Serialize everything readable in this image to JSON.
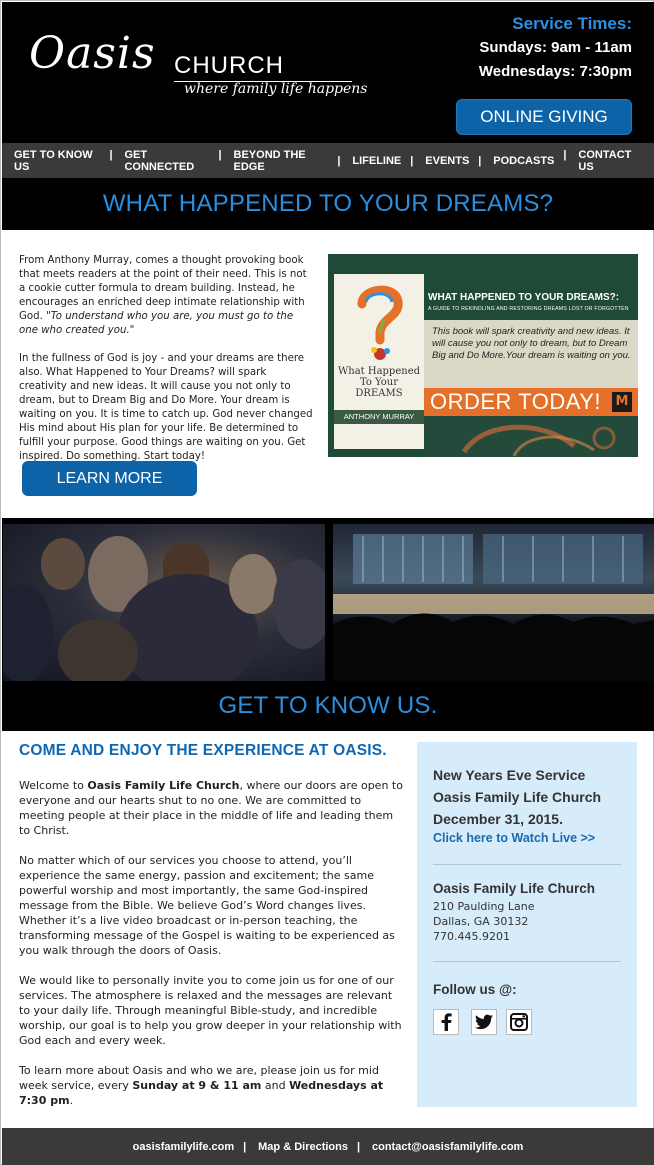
{
  "header": {
    "logo_word": "Oasis",
    "logo_church": "CHURCH",
    "logo_tagline": "where family life happens",
    "service_title": "Service Times:",
    "sundays": "Sundays: 9am - 11am",
    "wednesdays": "Wednesdays: 7:30pm",
    "giving_label": "ONLINE GIVING"
  },
  "nav": {
    "items": [
      {
        "label": "GET TO KNOW US"
      },
      {
        "label": "GET CONNECTED"
      },
      {
        "label": "BEYOND THE EDGE"
      },
      {
        "label": "LIFELINE"
      },
      {
        "label": "EVENTS"
      },
      {
        "label": "PODCASTS"
      },
      {
        "label": "CONTACT US"
      }
    ]
  },
  "dreams": {
    "heading": "WHAT HAPPENED TO YOUR DREAMS?",
    "para1_lead": "From Anthony Murray, comes a thought provoking book that meets readers at the point of their need. This is not a cookie cutter formula to dream building. Instead, he encourages an enriched deep intimate relationship with God. ",
    "para1_quote": "\"To understand who you are, you must go to the one who created you.\"",
    "para2": "In the fullness of God is joy - and your dreams are there also. What Happened to Your Dreams? will spark creativity and new ideas. It will cause you not only to dream, but to Dream Big and Do More. Your dream is waiting on you. It is time to catch up. God never changed His mind about His plan for your life. Be determined to fulfill your purpose. Good things are waiting on you. Get inspired. Do something. Start today!",
    "learn_more": "LEARN MORE",
    "ad": {
      "book_title_line1": "What Happened",
      "book_title_line2": "To Your",
      "book_title_line3": "DREAMS",
      "author": "ANTHONY MURRAY",
      "headline": "WHAT HAPPENED TO YOUR DREAMS?:",
      "subhead": "A GUIDE TO REKINDLING AND RESTORING DREAMS LOST OR FORGOTTEN",
      "panel_text": "This book will spark creativity and new ideas. It will cause you not only to dream, but to Dream Big and Do More.Your dream is waiting on you.",
      "order": "ORDER TODAY!"
    }
  },
  "about": {
    "heading": "GET TO KNOW US.",
    "subheading": "COME AND ENJOY THE EXPERIENCE AT OASIS.",
    "p1_a": "Welcome to ",
    "p1_bold": "Oasis Family Life Church",
    "p1_b": ", where our doors are open to everyone and our hearts shut to no one. We are committed to meeting people at their place in the middle of life and leading them to Christ.",
    "p2": "No matter which of our services you choose to attend, you’ll experience the same energy, passion and excitement; the same powerful worship and most importantly, the same God-inspired message from the Bible. We believe God’s Word changes lives. Whether it’s a live video broadcast or in-person teaching, the transforming message of the Gospel is waiting to be experienced as you walk through the doors of Oasis.",
    "p3": "We would like to personally invite you to come join us for one of our services. The atmosphere is relaxed and the messages are relevant to your daily life. Through meaningful Bible-study, and incredible worship, our goal is to help you grow deeper in your relationship with God each and every week.",
    "p4_a": "To learn more about Oasis and who we are, please join us for mid week service, every ",
    "p4_bold1": "Sunday at 9 & 11 am",
    "p4_b": " and ",
    "p4_bold2": "Wednesdays at 7:30 pm",
    "p4_c": "."
  },
  "sidebar": {
    "event_line1": "New Years Eve Service",
    "event_line2": "Oasis Family Life Church",
    "event_line3": "December 31, 2015.",
    "watch_live": "Click here to Watch Live  >>",
    "org_name": "Oasis Family Life Church",
    "address1": "210 Paulding Lane",
    "address2": "Dallas, GA 30132",
    "phone": "770.445.9201",
    "follow": "Follow us @:",
    "social_icons": [
      "facebook-icon",
      "twitter-icon",
      "instagram-icon"
    ]
  },
  "footer": {
    "site": "oasisfamilylife.com",
    "map": "Map & Directions",
    "email": "contact@oasisfamilylife.com"
  },
  "colors": {
    "accent_blue": "#2b8fe0",
    "button_blue": "#0d63a8",
    "nav_gray": "#3a3a3a",
    "sidebar_bg": "#d7ecfa",
    "order_orange": "#e4702a"
  }
}
